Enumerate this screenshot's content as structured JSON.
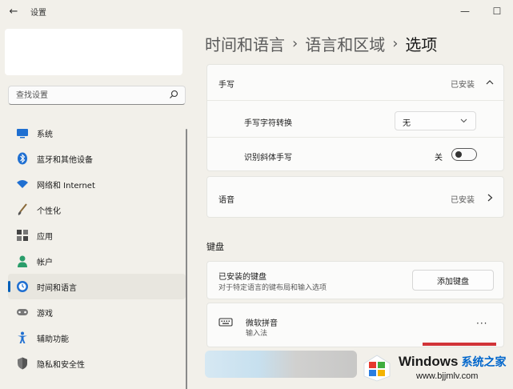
{
  "window": {
    "title": "设置",
    "back_icon": "←",
    "minimize_icon": "—",
    "maximize_icon": "☐"
  },
  "search": {
    "placeholder": "查找设置"
  },
  "sidebar": {
    "items": [
      {
        "label": "系统",
        "icon": "system-icon"
      },
      {
        "label": "蓝牙和其他设备",
        "icon": "bluetooth-icon"
      },
      {
        "label": "网络和 Internet",
        "icon": "wifi-icon"
      },
      {
        "label": "个性化",
        "icon": "brush-icon"
      },
      {
        "label": "应用",
        "icon": "apps-icon"
      },
      {
        "label": "帐户",
        "icon": "account-icon"
      },
      {
        "label": "时间和语言",
        "icon": "clock-globe-icon",
        "active": true
      },
      {
        "label": "游戏",
        "icon": "gamepad-icon"
      },
      {
        "label": "辅助功能",
        "icon": "accessibility-icon"
      },
      {
        "label": "隐私和安全性",
        "icon": "shield-icon"
      }
    ]
  },
  "breadcrumb": {
    "items": [
      "时间和语言",
      "语言和区域"
    ],
    "separator": "›",
    "current": "选项"
  },
  "handwriting": {
    "title": "手写",
    "status": "已安装",
    "convert_label": "手写字符转换",
    "convert_value": "无",
    "italic_label": "识别斜体手写",
    "italic_state": "关"
  },
  "speech": {
    "title": "语音",
    "status": "已安装"
  },
  "keyboard": {
    "section_title": "键盘",
    "installed_title": "已安装的键盘",
    "installed_desc": "对于特定语言的键布局和输入选项",
    "add_button": "添加键盘",
    "ime_name": "微软拼音",
    "ime_type": "输入法",
    "more_label": "···"
  },
  "watermark": {
    "brand": "Windows",
    "brand_cn": "系统之家",
    "url": "www.bjjmlv.com"
  },
  "colors": {
    "accent": "#005fb8",
    "background": "#f2f0ea",
    "card": "#fbfbfa",
    "highlight_red": "#d13438"
  }
}
